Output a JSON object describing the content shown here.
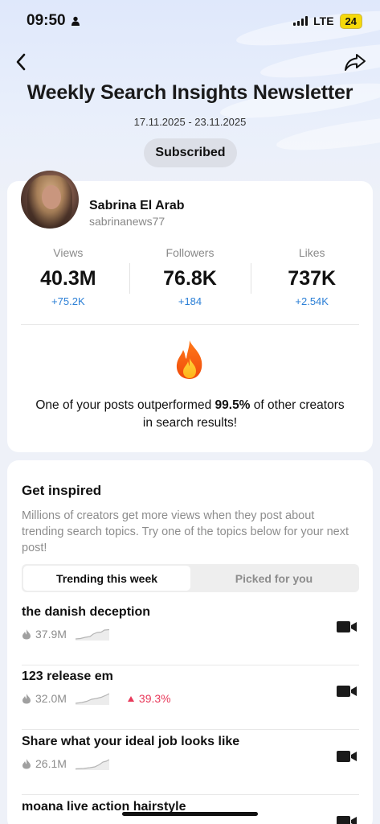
{
  "status_bar": {
    "time": "09:50",
    "network": "LTE",
    "battery": "24"
  },
  "header": {
    "title": "Weekly Search Insights Newsletter",
    "date_range": "17.11.2025 - 23.11.2025",
    "subscribed_label": "Subscribed"
  },
  "profile": {
    "name": "Sabrina El Arab",
    "handle": "sabrinanews77"
  },
  "stats": [
    {
      "label": "Views",
      "value": "40.3M",
      "delta": "+75.2K"
    },
    {
      "label": "Followers",
      "value": "76.8K",
      "delta": "+184"
    },
    {
      "label": "Likes",
      "value": "737K",
      "delta": "+2.54K"
    }
  ],
  "highlight": {
    "text_before": "One of your posts outperformed ",
    "percent": "99.5%",
    "text_after": " of other creators in search results!"
  },
  "inspired": {
    "title": "Get inspired",
    "description": "Millions of creators get more views when they post about trending search topics. Try one of the topics below for your next post!",
    "tabs": [
      {
        "label": "Trending this week",
        "active": true
      },
      {
        "label": "Picked for you",
        "active": false
      }
    ],
    "topics": [
      {
        "title": "the danish deception",
        "views": "37.9M",
        "growth": ""
      },
      {
        "title": "123 release em",
        "views": "32.0M",
        "growth": "39.3%"
      },
      {
        "title": "Share what your ideal job looks like",
        "views": "26.1M",
        "growth": ""
      },
      {
        "title": "moana live action hairstyle",
        "views": "",
        "growth": ""
      }
    ]
  },
  "colors": {
    "accent_blue": "#2b7fd6",
    "growth_red": "#e8395a"
  }
}
